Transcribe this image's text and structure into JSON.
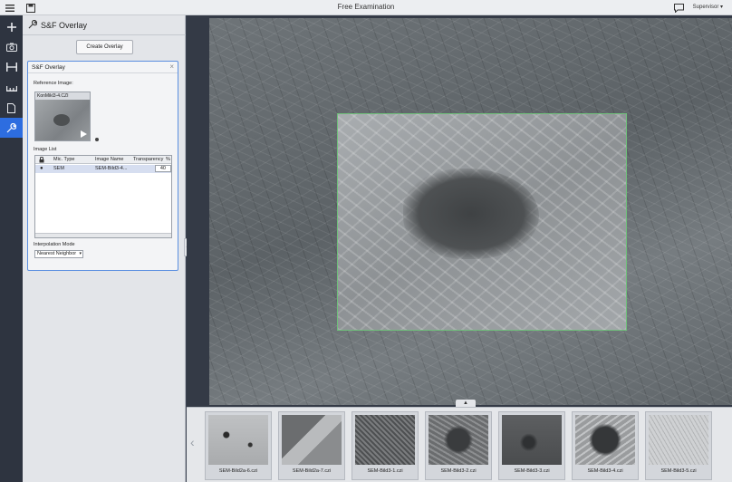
{
  "app": {
    "title": "Free Examination",
    "user_role": "Supervisor ▾"
  },
  "toolbar_left": {
    "items": [
      "add-icon",
      "camera-icon",
      "measure-icon",
      "scale-icon",
      "document-icon",
      "wrench-icon"
    ],
    "active": "wrench-icon"
  },
  "panel": {
    "title": "S&F Overlay",
    "create_button": "Create Overlay",
    "sf_box": {
      "title": "S&F Overlay",
      "reference_label": "Reference Image:",
      "reference_name": "KonMikl3-4.CZI",
      "image_list_label": "Image List",
      "columns": [
        "",
        "Mic. Type",
        "Image Name",
        "Transparency",
        "%"
      ],
      "rows": [
        {
          "mic_type": "SEM",
          "image_name": "SEM-Bild3-4...",
          "transparency": "40"
        }
      ],
      "interpolation_label": "Interpolation Mode",
      "interpolation_value": "Nearest Neighbor"
    }
  },
  "filmstrip": {
    "thumbnails": [
      {
        "name": "SEM-Bild2a-6.czi"
      },
      {
        "name": "SEM-Bild2a-7.czi"
      },
      {
        "name": "SEM-Bild3-1.czi"
      },
      {
        "name": "SEM-Bild3-2.czi"
      },
      {
        "name": "SEM-Bild3-3.czi"
      },
      {
        "name": "SEM-Bild3-4.czi"
      },
      {
        "name": "SEM-Bild3-5.czi"
      }
    ]
  },
  "colors": {
    "accent": "#2d6de0",
    "overlay_border": "#6fbf7a",
    "toolbar_bg": "#2e3440"
  }
}
